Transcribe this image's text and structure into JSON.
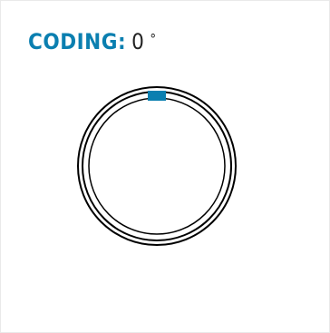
{
  "coding": {
    "label": "CODING:",
    "value": "0",
    "unit": "°"
  },
  "dial": {
    "angle_degrees": 0,
    "marker_color": "#0b7fb0",
    "ring_color": "#000000"
  }
}
